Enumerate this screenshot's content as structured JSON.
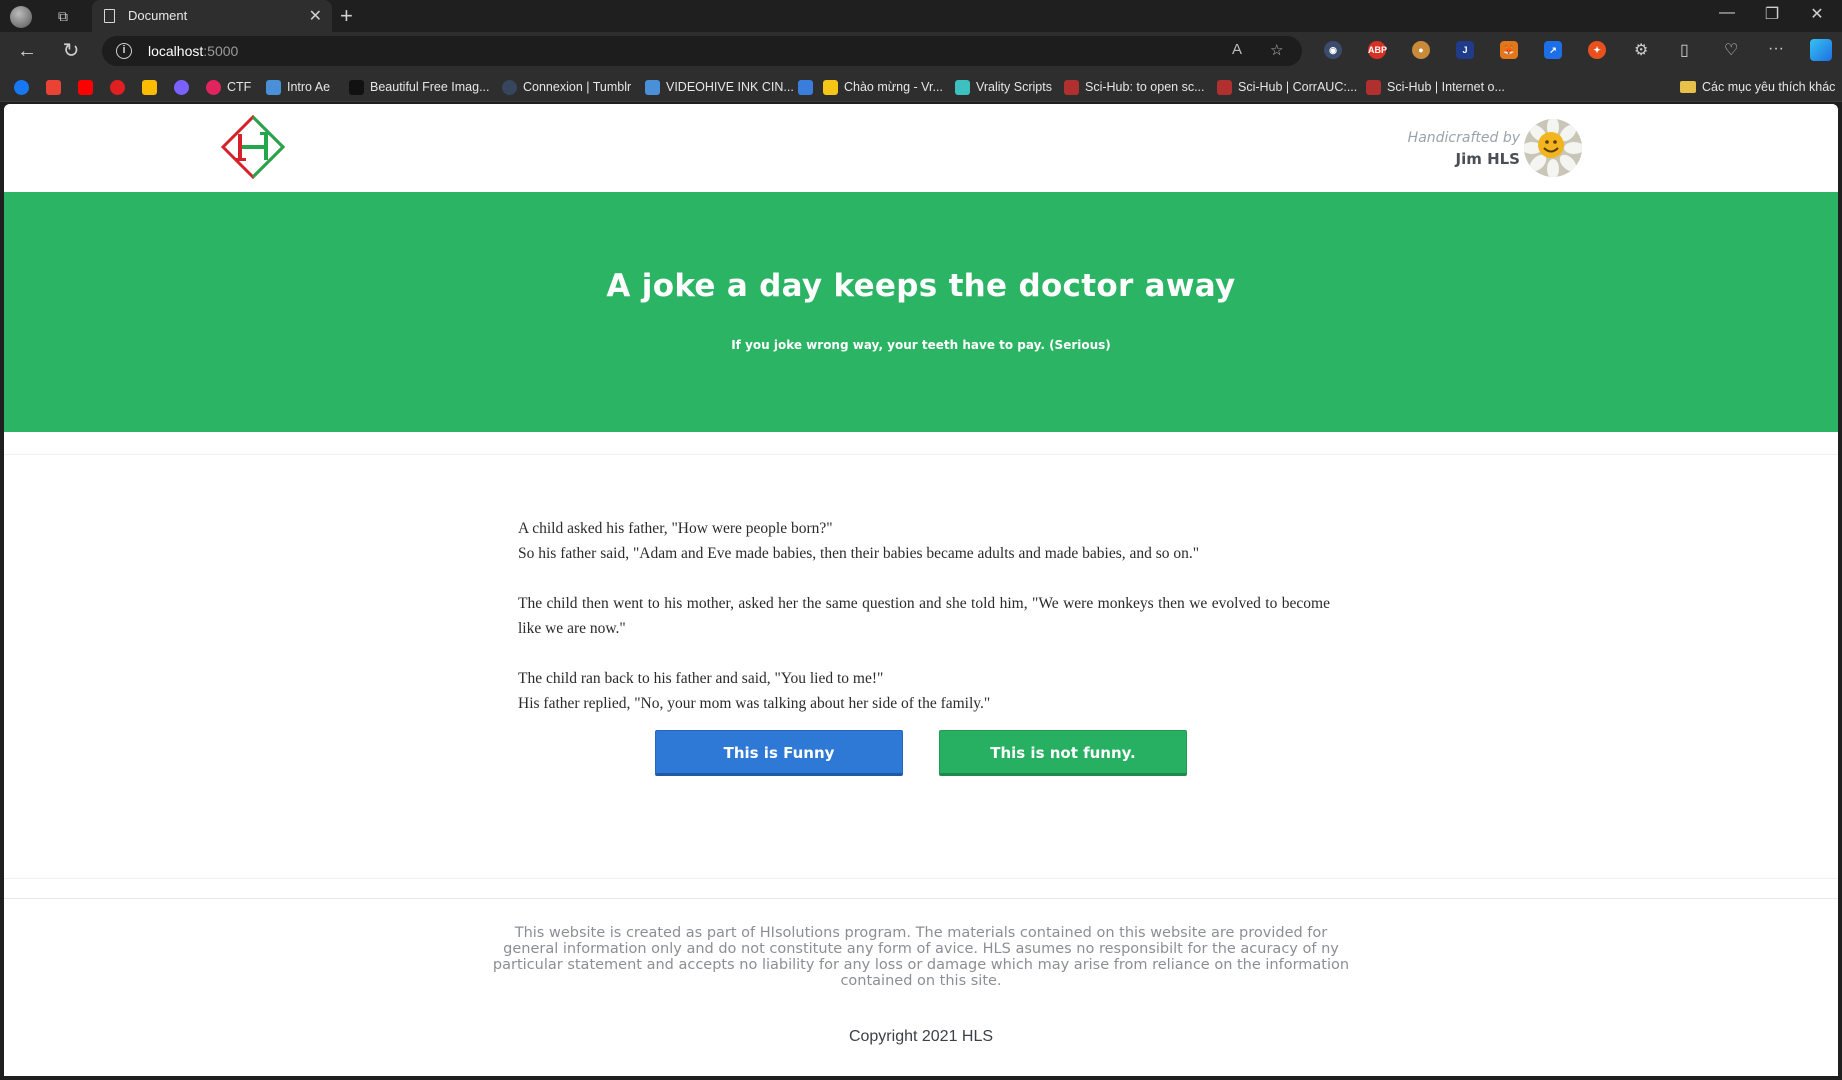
{
  "browser": {
    "tab_title": "Document",
    "url_host": "localhost",
    "url_port": ":5000",
    "bookmarks": [
      {
        "label": "",
        "color": "#1877f2"
      },
      {
        "label": "",
        "color": "#ea4335"
      },
      {
        "label": "",
        "color": "#ff0000"
      },
      {
        "label": "",
        "color": "#e02020"
      },
      {
        "label": "",
        "color": "#fbbc04"
      },
      {
        "label": "",
        "color": "#7b61ff"
      },
      {
        "label": "CTF",
        "color": "#e0245e"
      },
      {
        "label": "Intro Ae",
        "color": "#4a90d9"
      },
      {
        "label": "Beautiful Free Imag...",
        "color": "#111111"
      },
      {
        "label": "Connexion | Tumblr",
        "color": "#36465d"
      },
      {
        "label": "VIDEOHIVE INK CIN...",
        "color": "#4a90d9"
      },
      {
        "label": "",
        "color": "#3b7ddd"
      },
      {
        "label": "Chào mừng - Vr...",
        "color": "#f5c518"
      },
      {
        "label": "Vrality Scripts",
        "color": "#3cc0c0"
      },
      {
        "label": "Sci-Hub: to open sc...",
        "color": "#b03030"
      },
      {
        "label": "Sci-Hub | CorrAUC:...",
        "color": "#b03030"
      },
      {
        "label": "Sci-Hub | Internet o...",
        "color": "#b03030"
      }
    ],
    "bookmarks_folder": "Các mục yêu thích khác"
  },
  "header": {
    "logo_letter": "H",
    "handicrafted_label": "Handicrafted by",
    "author_name": "Jim HLS"
  },
  "hero": {
    "title": "A joke a day keeps the doctor away",
    "subtitle": "If you joke wrong way, your teeth have to pay. (Serious)"
  },
  "joke": {
    "paragraphs": [
      "A child asked his father, \"How were people born?\"",
      "So his father said, \"Adam and Eve made babies, then their babies became adults and made babies, and so on.\"",
      "The child then went to his mother, asked her the same question and she told him, \"We were monkeys then we evolved to become like we are now.\"",
      "The child ran back to his father and said, \"You lied to me!\"",
      "His father replied, \"No, your mom was talking about her side of the family.\""
    ]
  },
  "buttons": {
    "funny": "This is Funny",
    "not_funny": "This is not funny."
  },
  "footer": {
    "disclaimer": "This website is created as part of HIsolutions program. The materials contained on this website are provided for general information only and do not constitute any form of avice. HLS asumes no responsibilt for the acuracy of ny particular statement and accepts no liability for any loss or damage which may arise from reliance on the information contained on this site.",
    "copyright": "Copyright 2021 HLS"
  },
  "colors": {
    "hero_green": "#2bb463",
    "funny_blue": "#2e78d6",
    "not_funny_green": "#27b061",
    "logo_red": "#d6202a",
    "logo_green": "#22a84a"
  }
}
